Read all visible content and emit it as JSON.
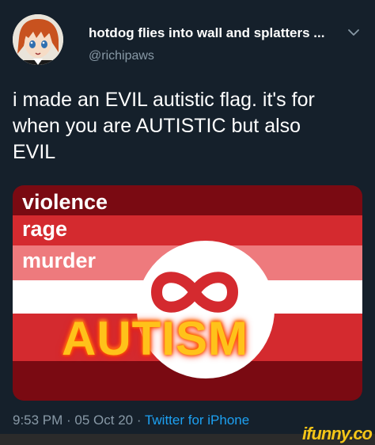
{
  "tweet": {
    "display_name": "hotdog flies into wall and splatters ...",
    "handle": "@richipaws",
    "text_lines": [
      "i made an EVIL autistic flag. it's for",
      "when you are AUTISTIC but also",
      "EVIL"
    ],
    "timestamp": "9:53 PM · 05 Oct 20 · ",
    "source": "Twitter for iPhone"
  },
  "flag": {
    "labels": [
      "violence",
      "rage",
      "murder"
    ],
    "center_word": "AUTISM",
    "stripe_colors": [
      "#7a0a12",
      "#d42a2f",
      "#ee7a7d",
      "#ffffff",
      "#d42a2f",
      "#7a0a12"
    ]
  },
  "watermark": {
    "text": "ifunny.co"
  },
  "icons": {
    "chevron": "chevron-down-icon",
    "avatar": "avatar"
  }
}
